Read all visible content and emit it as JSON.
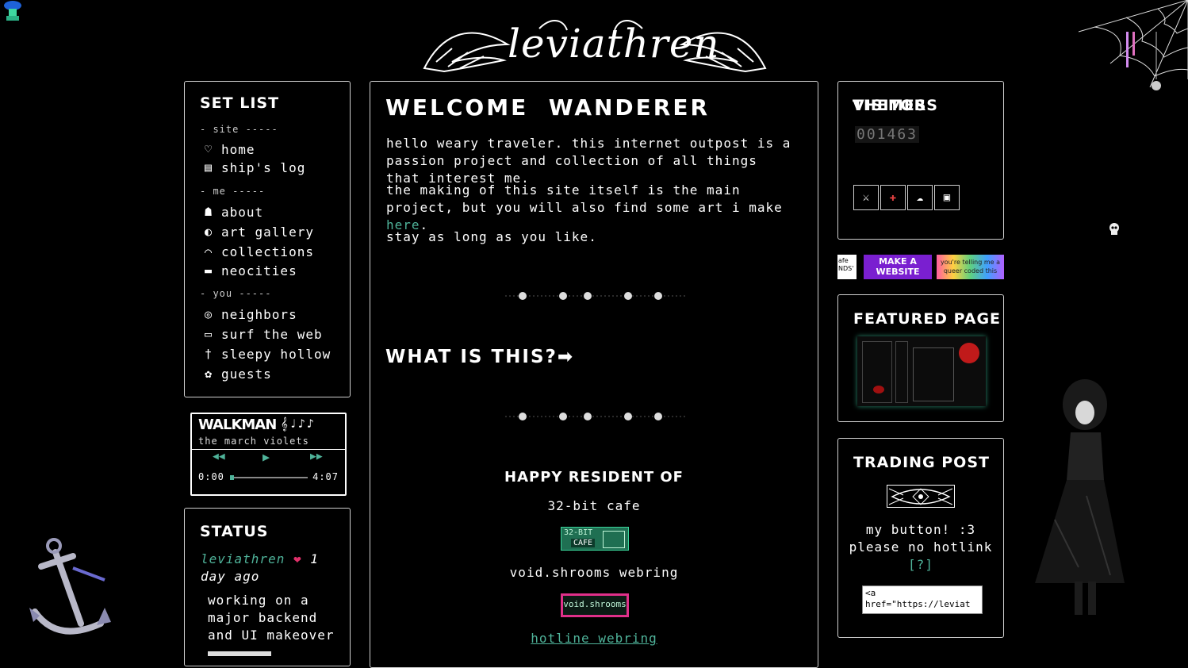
{
  "logo": {
    "text": "leviathren"
  },
  "nav": {
    "title": "SET LIST",
    "sections": [
      {
        "label": "- site -----",
        "items": [
          {
            "label": "home",
            "icon": "heart-icon"
          },
          {
            "label": "ship's log",
            "icon": "notebook-icon"
          }
        ]
      },
      {
        "label": "- me -----",
        "items": [
          {
            "label": "about",
            "icon": "ghost-icon"
          },
          {
            "label": "art gallery",
            "icon": "moon-icon"
          },
          {
            "label": "collections",
            "icon": "shelf-icon"
          },
          {
            "label": "neocities",
            "icon": "computer-icon"
          }
        ]
      },
      {
        "label": "- you -----",
        "items": [
          {
            "label": "neighbors",
            "icon": "spiral-icon"
          },
          {
            "label": "surf the web",
            "icon": "computer-icon"
          },
          {
            "label": "sleepy hollow",
            "icon": "cross-icon"
          },
          {
            "label": "guests",
            "icon": "flower-icon"
          }
        ]
      }
    ]
  },
  "walkman": {
    "title": "WALKMAN",
    "notes": "𝄞♩♪♪",
    "track": "the march violets",
    "current_time": "0:00",
    "duration": "4:07",
    "progress": 0.0
  },
  "status": {
    "title": "STATUS",
    "user": "leviathren",
    "heart": "❤",
    "time_ago": "1 day ago",
    "message": "working on a major backend and UI makeover"
  },
  "main": {
    "title": "WELCOME  WANDERER",
    "intro": "hello weary traveler. this internet outpost is a passion project and collection of all things that interest me.",
    "making_text": "the making of this site itself is the main project, but you will also find some art i make ",
    "making_link": "here",
    "making_end": ".",
    "stay": "stay as long as you like.",
    "what_heading": "WHAT IS THIS?➡",
    "resident_heading": "HAPPY RESIDENT OF",
    "rings": [
      {
        "name": "32-bit cafe",
        "badge_top": "32-BIT",
        "badge_bottom": "CAFE"
      },
      {
        "name": "void.shrooms webring",
        "badge": "void.shrooms"
      },
      {
        "name": "hotline webring"
      }
    ]
  },
  "visitors": {
    "title": "VISITORS",
    "count": "001463"
  },
  "themes": {
    "title": "THEMES",
    "options": [
      {
        "icon": "sword-icon",
        "glyph": "⚔"
      },
      {
        "icon": "syringe-icon",
        "glyph": "✚"
      },
      {
        "icon": "cloud-icon",
        "glyph": "☁"
      },
      {
        "icon": "computer-icon",
        "glyph": "▣"
      }
    ]
  },
  "buttons88": [
    {
      "text": "afe\nNDS'"
    },
    {
      "text": "MAKE A\nWEBSITE"
    },
    {
      "text": "you're telling me a\nqueer coded this"
    }
  ],
  "featured": {
    "title": "FEATURED PAGE"
  },
  "trading": {
    "title": "TRADING POST",
    "caption_line1": "my button! :3",
    "caption_line2": "please no hotlink",
    "help": "[?]",
    "code": "<a\nhref=\"https://leviat"
  },
  "colors": {
    "accent": "#4fb39a",
    "background": "#000000",
    "border": "#cfcfcf",
    "heart": "#e0306a"
  }
}
